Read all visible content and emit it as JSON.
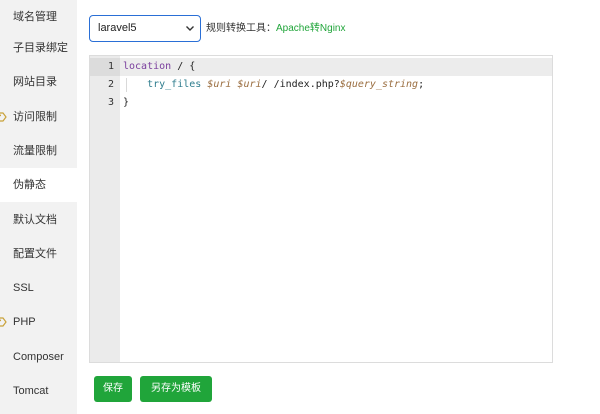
{
  "sidebar": {
    "items": [
      {
        "label": "域名管理",
        "icon": "",
        "active": false
      },
      {
        "label": "子目录绑定",
        "icon": "",
        "active": false
      },
      {
        "label": "网站目录",
        "icon": "",
        "active": false
      },
      {
        "label": "访问限制",
        "icon": "tag-icon",
        "active": false
      },
      {
        "label": "流量限制",
        "icon": "",
        "active": false
      },
      {
        "label": "伪静态",
        "icon": "",
        "active": true
      },
      {
        "label": "默认文档",
        "icon": "",
        "active": false
      },
      {
        "label": "配置文件",
        "icon": "",
        "active": false
      },
      {
        "label": "SSL",
        "icon": "",
        "active": false
      },
      {
        "label": "PHP",
        "icon": "tag-icon",
        "active": false
      },
      {
        "label": "Composer",
        "icon": "",
        "active": false
      },
      {
        "label": "Tomcat",
        "icon": "",
        "active": false
      }
    ]
  },
  "rewrite": {
    "selected": "laravel5",
    "tool_label": "规则转换工具：",
    "tool_link": "Apache转Nginx"
  },
  "editor": {
    "line_numbers": [
      "1",
      "2",
      "3"
    ],
    "lines": [
      [
        {
          "t": "location",
          "c": "kw"
        },
        {
          "t": " / {",
          "c": ""
        }
      ],
      [
        {
          "t": "    ",
          "c": ""
        },
        {
          "t": "try_files",
          "c": "fn"
        },
        {
          "t": " ",
          "c": ""
        },
        {
          "t": "$uri",
          "c": "var"
        },
        {
          "t": " ",
          "c": ""
        },
        {
          "t": "$uri",
          "c": "var"
        },
        {
          "t": "/ /index.php?",
          "c": ""
        },
        {
          "t": "$query_string",
          "c": "var"
        },
        {
          "t": ";",
          "c": ""
        }
      ],
      [
        {
          "t": "}",
          "c": ""
        }
      ]
    ]
  },
  "buttons": {
    "save": "保存",
    "save_as_template": "另存为模板"
  },
  "colors": {
    "accent_green": "#20a53a",
    "select_border": "#2a6fd6",
    "sidebar_bg": "#f2f2f2"
  }
}
